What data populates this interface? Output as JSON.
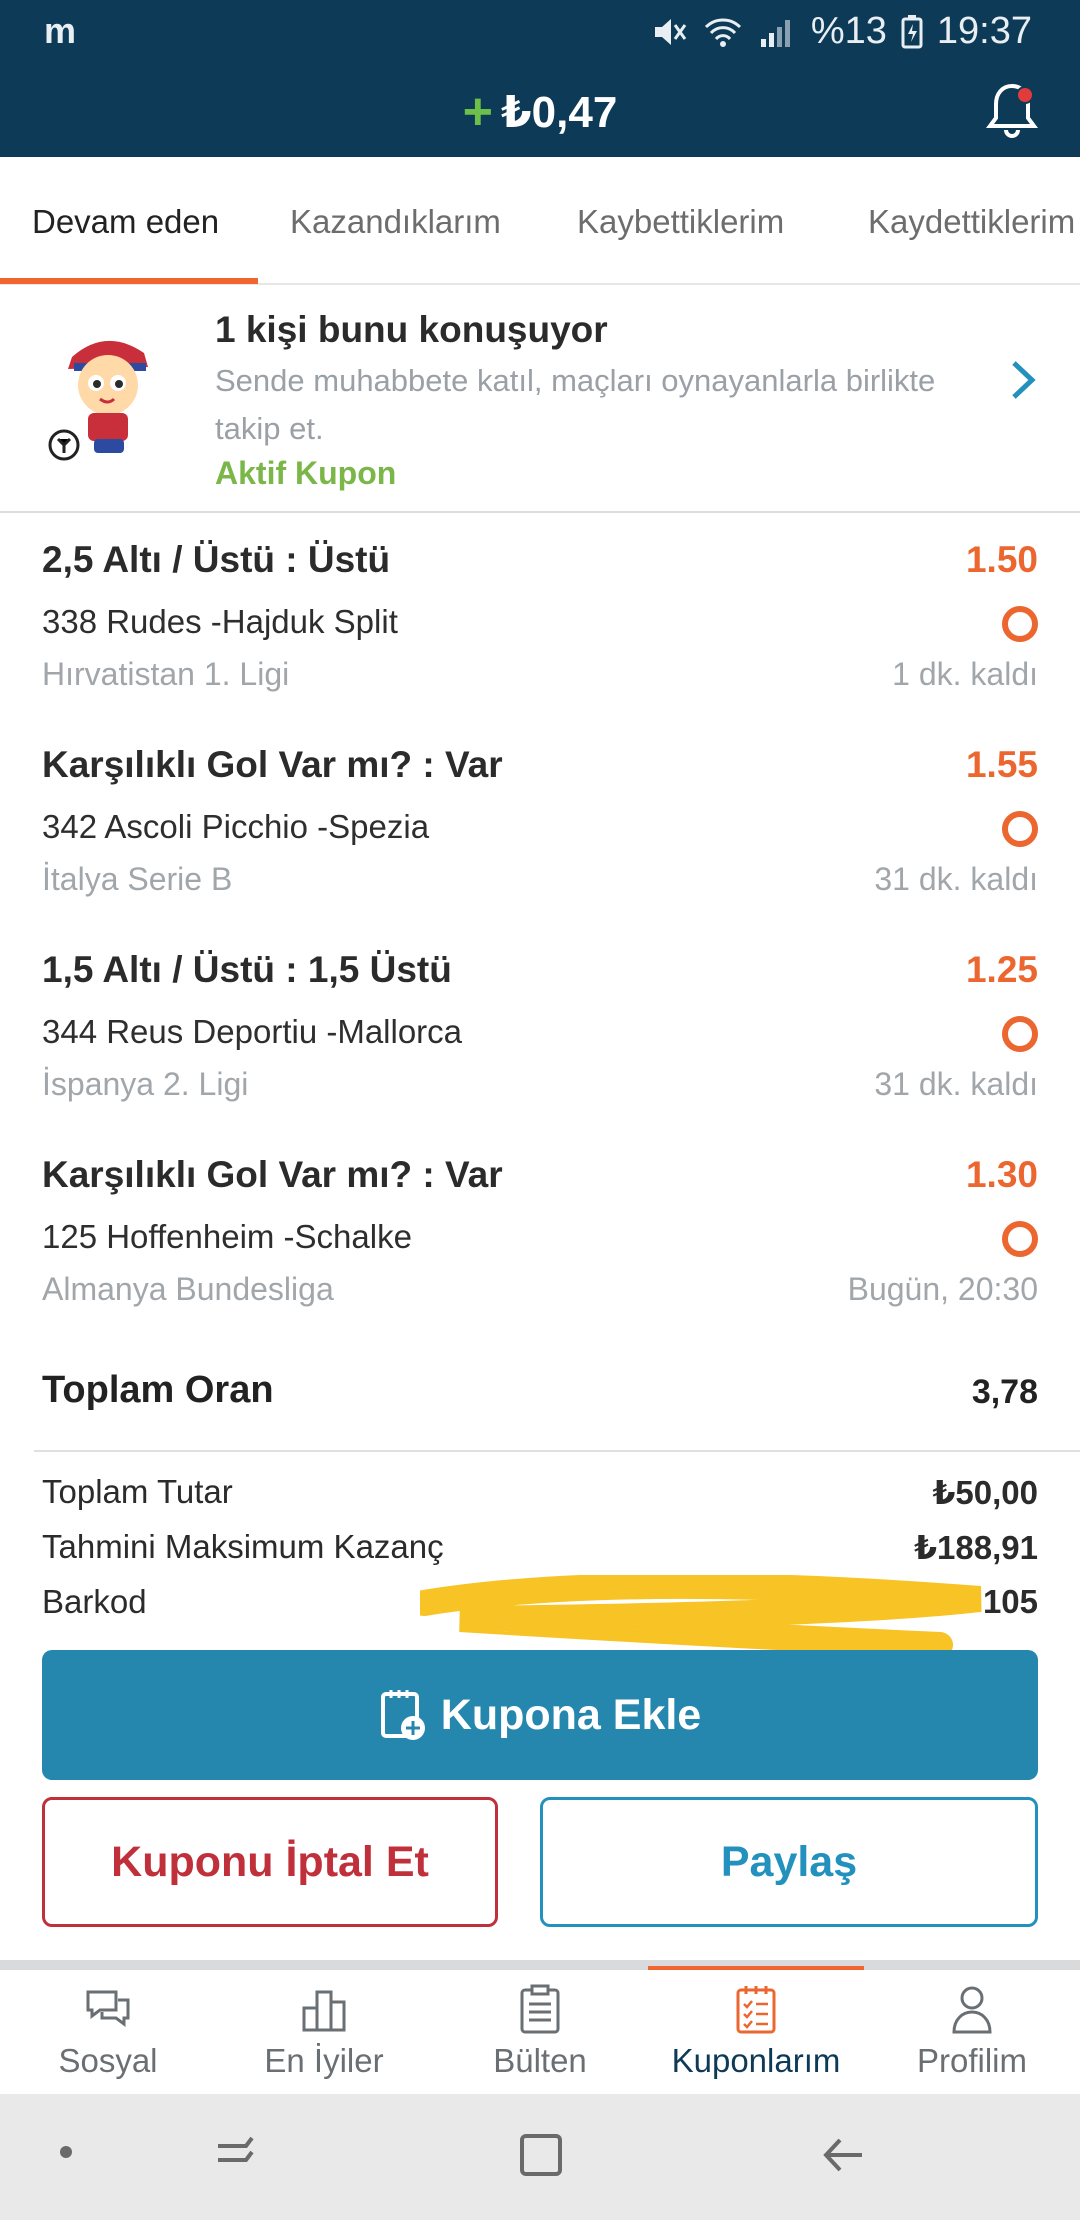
{
  "status_bar": {
    "app_letter": "m",
    "battery": "%13",
    "time": "19:37"
  },
  "header": {
    "balance": "₺0,47",
    "plus_symbol": "+"
  },
  "tabs": [
    {
      "label": "Devam eden",
      "active": true
    },
    {
      "label": "Kazandıklarım",
      "active": false
    },
    {
      "label": "Kaybettiklerim",
      "active": false
    },
    {
      "label": "Kaydettiklerim",
      "active": false
    }
  ],
  "banner": {
    "title": "1 kişi bunu konuşuyor",
    "text": "Sende muhabbete katıl, maçları oynayanlarla birlikte takip et.",
    "link": "Aktif Kupon"
  },
  "bets": [
    {
      "selection": "2,5 Altı / Üstü : Üstü",
      "odd": "1.50",
      "match": "338 Rudes -Hajduk Split",
      "league": "Hırvatistan 1. Ligi",
      "time": "1 dk. kaldı"
    },
    {
      "selection": "Karşılıklı Gol Var mı? : Var",
      "odd": "1.55",
      "match": "342 Ascoli Picchio -Spezia",
      "league": "İtalya Serie B",
      "time": "31 dk. kaldı"
    },
    {
      "selection": "1,5 Altı / Üstü : 1,5 Üstü",
      "odd": "1.25",
      "match": "344 Reus Deportiu -Mallorca",
      "league": "İspanya 2. Ligi",
      "time": "31 dk. kaldı"
    },
    {
      "selection": "Karşılıklı Gol Var mı? : Var",
      "odd": "1.30",
      "match": "125 Hoffenheim -Schalke",
      "league": "Almanya Bundesliga",
      "time": "Bugün, 20:30"
    }
  ],
  "totals": {
    "odds_label": "Toplam Oran",
    "odds_value": "3,78",
    "amount_label": "Toplam Tutar",
    "amount_value": "₺50,00",
    "max_win_label": "Tahmini Maksimum Kazanç",
    "max_win_value": "₺188,91",
    "barcode_label": "Barkod",
    "barcode_value": "105"
  },
  "buttons": {
    "add": "Kupona Ekle",
    "cancel": "Kuponu İptal Et",
    "share": "Paylaş"
  },
  "bottom_nav": [
    {
      "label": "Sosyal",
      "icon": "chat-icon",
      "active": false
    },
    {
      "label": "En İyiler",
      "icon": "podium-icon",
      "active": false
    },
    {
      "label": "Bülten",
      "icon": "clipboard-icon",
      "active": false
    },
    {
      "label": "Kuponlarım",
      "icon": "coupon-icon",
      "active": true
    },
    {
      "label": "Profilim",
      "icon": "person-icon",
      "active": false
    }
  ],
  "colors": {
    "header_bg": "#0d3a56",
    "accent": "#ec6630",
    "primary_button": "#2587ad",
    "cancel": "#c0303b",
    "link_green": "#7ab648"
  }
}
